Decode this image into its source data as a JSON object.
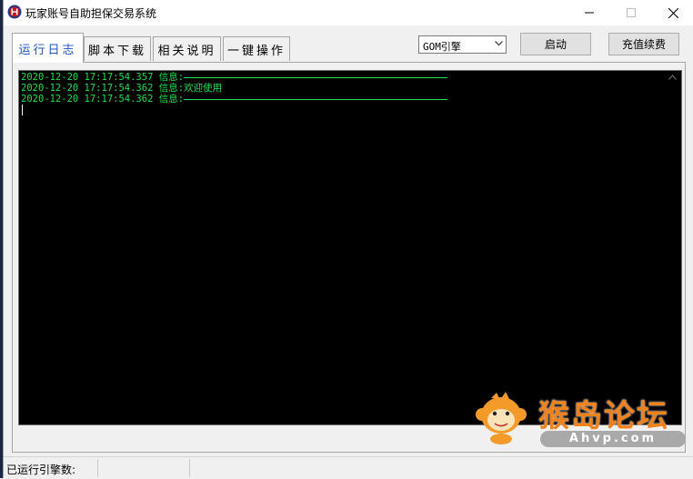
{
  "window": {
    "title": "玩家账号自助担保交易系统",
    "icon": "app-logo-icon",
    "controls": [
      "minimize-icon",
      "maximize-icon",
      "close-icon"
    ]
  },
  "tabs": [
    {
      "label": "运行日志",
      "active": true
    },
    {
      "label": "脚本下载",
      "active": false
    },
    {
      "label": "相关说明",
      "active": false
    },
    {
      "label": "一键操作",
      "active": false
    }
  ],
  "toolbar": {
    "engine_select": {
      "value": "GOM引擎"
    },
    "start_label": "启动",
    "recharge_label": "充值续费"
  },
  "log": {
    "lines": [
      {
        "timestamp": "2020-12-20 17:17:54.357",
        "prefix": "信息:",
        "message": ""
      },
      {
        "timestamp": "2020-12-20 17:17:54.362",
        "prefix": "信息:",
        "message": "欢迎使用"
      },
      {
        "timestamp": "2020-12-20 17:17:54.362",
        "prefix": "信息:",
        "message": ""
      }
    ]
  },
  "watermark": {
    "brand": "猴岛论坛",
    "domain": "Ahvp.com"
  },
  "statusbar": {
    "engine_count_label": "已运行引擎数:"
  },
  "colors": {
    "log_text": "#22e050",
    "active_tab": "#1a56c4",
    "watermark": "#f0821e"
  }
}
